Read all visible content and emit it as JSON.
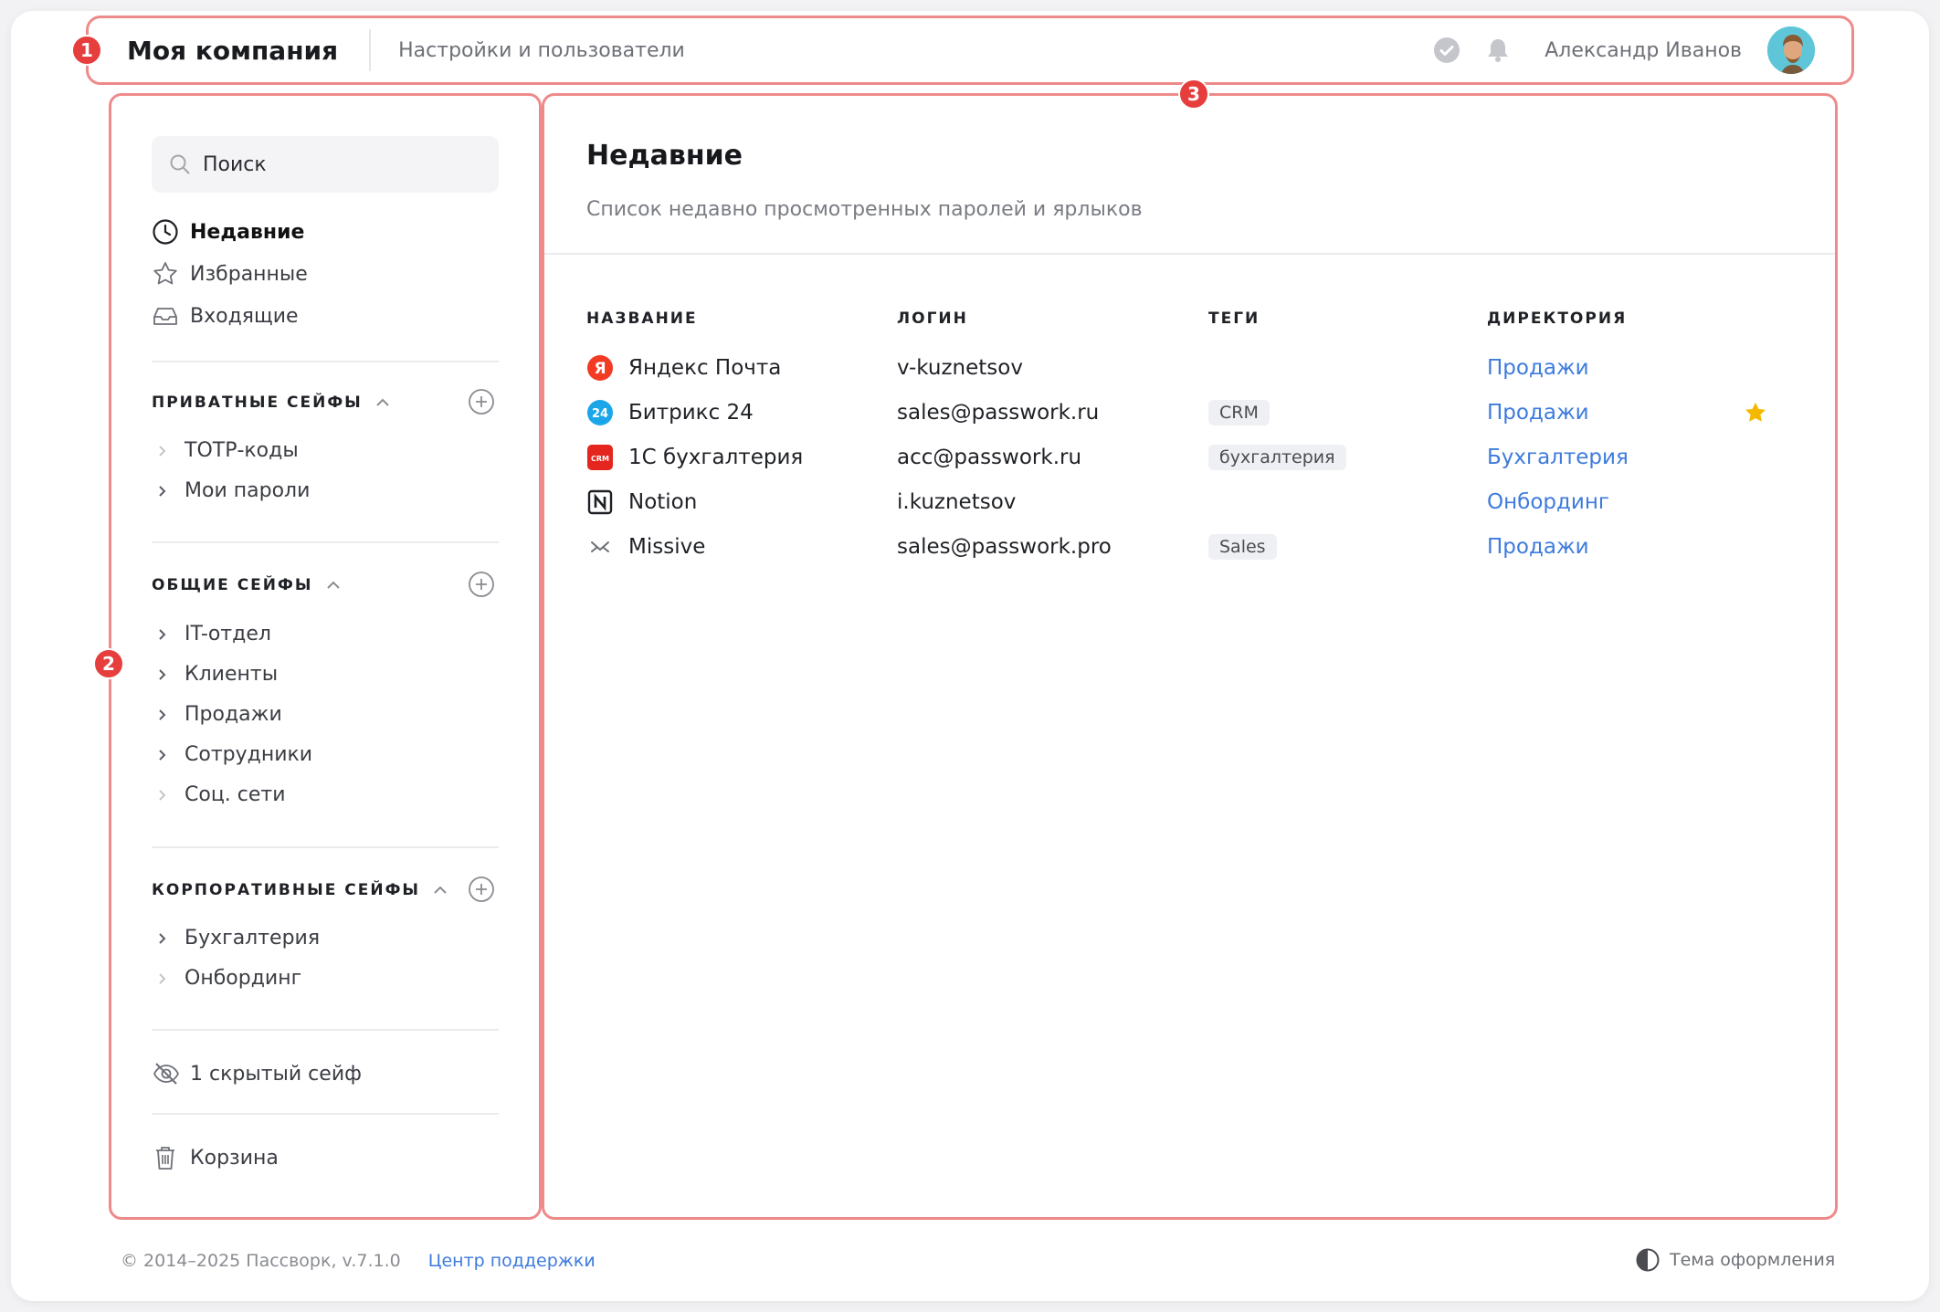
{
  "header": {
    "company": "Моя компания",
    "subtitle": "Настройки и пользователи",
    "user_name": "Александр Иванов"
  },
  "badges": [
    "1",
    "2",
    "3"
  ],
  "sidebar": {
    "search_placeholder": "Поиск",
    "nav": [
      {
        "label": "Недавние",
        "icon": "clock-icon",
        "active": true
      },
      {
        "label": "Избранные",
        "icon": "star-icon"
      },
      {
        "label": "Входящие",
        "icon": "inbox-icon"
      }
    ],
    "sections": [
      {
        "title": "ПРИВАТНЫЕ СЕЙФЫ",
        "vaults": [
          "ТОТР-коды",
          "Мои пароли"
        ]
      },
      {
        "title": "ОБЩИЕ СЕЙФЫ",
        "vaults": [
          "IT-отдел",
          "Клиенты",
          "Продажи",
          "Сотрудники",
          "Соц. сети"
        ]
      },
      {
        "title": "КОРПОРАТИВНЫЕ СЕЙФЫ",
        "vaults": [
          "Бухгалтерия",
          "Онбординг"
        ]
      }
    ],
    "hidden": "1 скрытый сейф",
    "trash": "Корзина"
  },
  "main": {
    "title": "Недавние",
    "description": "Список недавно просмотренных паролей и ярлыков",
    "columns": [
      "НАЗВАНИЕ",
      "ЛОГИН",
      "ТЕГИ",
      "ДИРЕКТОРИЯ"
    ],
    "rows": [
      {
        "name": "Яндекс Почта",
        "icon": "yandex-icon",
        "login": "v-kuznetsov",
        "tag": "",
        "dir": "Продажи",
        "favorite": false
      },
      {
        "name": "Битрикс 24",
        "icon": "bitrix-icon",
        "login": "sales@passwork.ru",
        "tag": "CRM",
        "dir": "Продажи",
        "favorite": true
      },
      {
        "name": "1С бухгалтерия",
        "icon": "1c-icon",
        "login": "acc@passwork.ru",
        "tag": "бухгалтерия",
        "dir": "Бухгалтерия",
        "favorite": false
      },
      {
        "name": "Notion",
        "icon": "notion-icon",
        "login": "i.kuznetsov",
        "tag": "",
        "dir": "Онбординг",
        "favorite": false
      },
      {
        "name": "Missive",
        "icon": "missive-icon",
        "login": "sales@passwork.pro",
        "tag": "Sales",
        "dir": "Продажи",
        "favorite": false
      }
    ]
  },
  "footer": {
    "copyright": "© 2014–2025 Пассворк, v.7.1.0",
    "support": "Центр поддержки",
    "theme": "Тема оформления"
  },
  "colors": {
    "accent": "#3e7bdd",
    "highlight": "#ee8a8a",
    "badge": "#e63d3d",
    "star": "#f5b800"
  }
}
